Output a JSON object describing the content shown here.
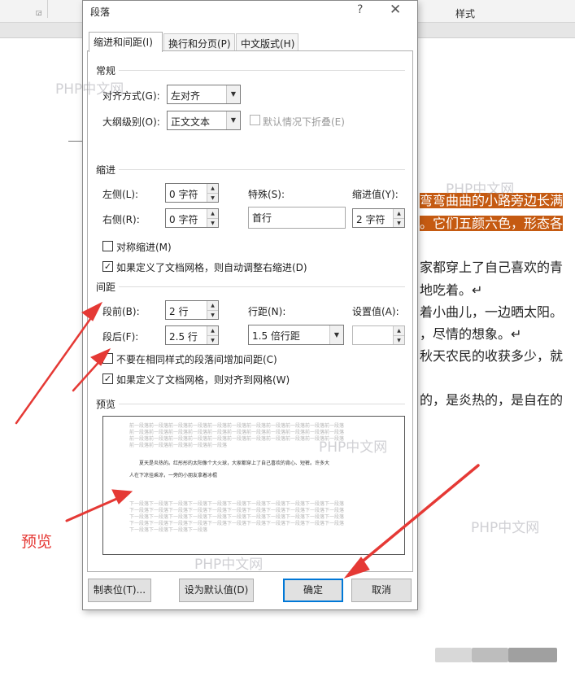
{
  "background": {
    "ribbon_styles_label": "样式",
    "doc_lines": [
      "弯弯曲曲的小路旁边长满",
      "。它们五颜六色，形态各",
      "家都穿上了自己喜欢的青",
      "地吃着。↵",
      "着小曲儿，一边晒太阳。",
      "，尽情的想象。↵",
      "秋天农民的收获多少，就",
      "的，是炎热的，是自在的"
    ],
    "watermark": "PHP中文网"
  },
  "dialog": {
    "title": "段落",
    "help": "?",
    "close": "✕",
    "tabs": [
      "缩进和间距(I)",
      "换行和分页(P)",
      "中文版式(H)"
    ],
    "general": {
      "heading": "常规",
      "alignment_label": "对齐方式(G):",
      "alignment_value": "左对齐",
      "outline_label": "大纲级别(O):",
      "outline_value": "正文文本",
      "collapse_label": "默认情况下折叠(E)"
    },
    "indent": {
      "heading": "缩进",
      "left_label": "左侧(L):",
      "left_value": "0 字符",
      "right_label": "右侧(R):",
      "right_value": "0 字符",
      "special_label": "特殊(S):",
      "special_value": "首行",
      "by_label": "缩进值(Y):",
      "by_value": "2 字符",
      "mirror_label": "对称缩进(M)",
      "auto_adjust_label": "如果定义了文档网格，则自动调整右缩进(D)"
    },
    "spacing": {
      "heading": "间距",
      "before_label": "段前(B):",
      "before_value": "2 行",
      "after_label": "段后(F):",
      "after_value": "2.5 行",
      "line_label": "行距(N):",
      "line_value": "1.5 倍行距",
      "at_label": "设置值(A):",
      "at_value": "",
      "no_space_label": "不要在相同样式的段落间增加间距(C)",
      "snap_grid_label": "如果定义了文档网格，则对齐到网格(W)"
    },
    "preview": {
      "heading": "预览",
      "prev_lines": [
        "前一段落前一段落前一段落前一段落前一段落前一段落前一段落前一段落前一段落前一段落前一段落",
        "前一段落前一段落前一段落前一段落前一段落前一段落前一段落前一段落前一段落前一段落前一段落",
        "前一段落前一段落前一段落前一段落前一段落前一段落前一段落前一段落前一段落前一段落前一段落",
        "前一段落前一段落前一段落前一段落前一段落"
      ],
      "sample_line1": "夏天是炎热的。红彤彤的太阳像个大火球，大家都穿上了自己喜欢的背心、短裤。许多大",
      "sample_line2": "人在下凉挂乘凉，一旁的小朋友拿着冰棍",
      "next_lines": [
        "下一段落下一段落下一段落下一段落下一段落下一段落下一段落下一段落下一段落下一段落下一段落",
        "下一段落下一段落下一段落下一段落下一段落下一段落下一段落下一段落下一段落下一段落下一段落",
        "下一段落下一段落下一段落下一段落下一段落下一段落下一段落下一段落下一段落下一段落下一段落",
        "下一段落下一段落下一段落下一段落下一段落下一段落下一段落下一段落下一段落下一段落下一段落",
        "下一段落下一段落下一段落下一段落"
      ]
    },
    "buttons": {
      "tabs": "制表位(T)...",
      "set_default": "设为默认值(D)",
      "ok": "确定",
      "cancel": "取消"
    }
  },
  "annotation": {
    "label": "预览",
    "arrow_color": "#e53935"
  },
  "colors": {
    "highlight": "#c55a11",
    "default_button_border": "#0078d7"
  }
}
